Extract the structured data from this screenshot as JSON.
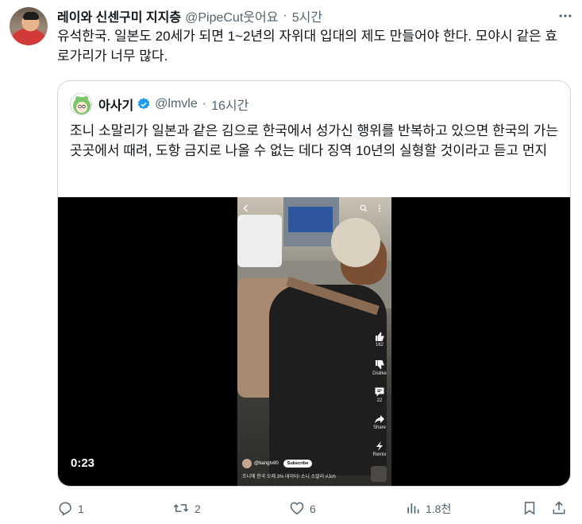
{
  "post": {
    "author_name": "레이와 신센구미 지지층",
    "author_handle": "@PipeCut웃어요",
    "separator": "·",
    "time": "5시간",
    "text": "유석한국. 일본도 20세가 되면 1~2년의 자위대 입대의 제도 만들어야 한다. 모야시 같은 효로가리가 너무 많다."
  },
  "quote": {
    "author_name": "아사기",
    "author_handle": "@lmvle",
    "separator": "·",
    "time": "16시간",
    "text": "조니 소말리가 일본과 같은 김으로 한국에서 성가신 행위를 반복하고 있으면 한국의 가는 곳곳에서 때려, 도항 금지로 나올 수 없는 데다 징역 10년의 실형할 것이라고 듣고 먼지",
    "video": {
      "duration": "0:23",
      "side_labels": {
        "like": "162",
        "dislike": "Dislike",
        "comments": "22",
        "share": "Share",
        "remix": "Remix"
      },
      "channel": "@bangtv80",
      "subscribe_label": "Subscribe",
      "caption": "조니에 한국 오레 3% 데이터! 소니 소말리 #Joh"
    }
  },
  "actions": {
    "replies": "1",
    "retweets": "2",
    "likes": "6",
    "views": "1.8천"
  },
  "colors": {
    "text_primary": "#0f1419",
    "text_secondary": "#536471",
    "border": "#cfd9de",
    "verified": "#1d9bf0"
  },
  "icons": [
    "more-icon",
    "verified-icon",
    "reply-icon",
    "retweet-icon",
    "like-icon",
    "views-icon",
    "bookmark-icon",
    "share-icon"
  ]
}
